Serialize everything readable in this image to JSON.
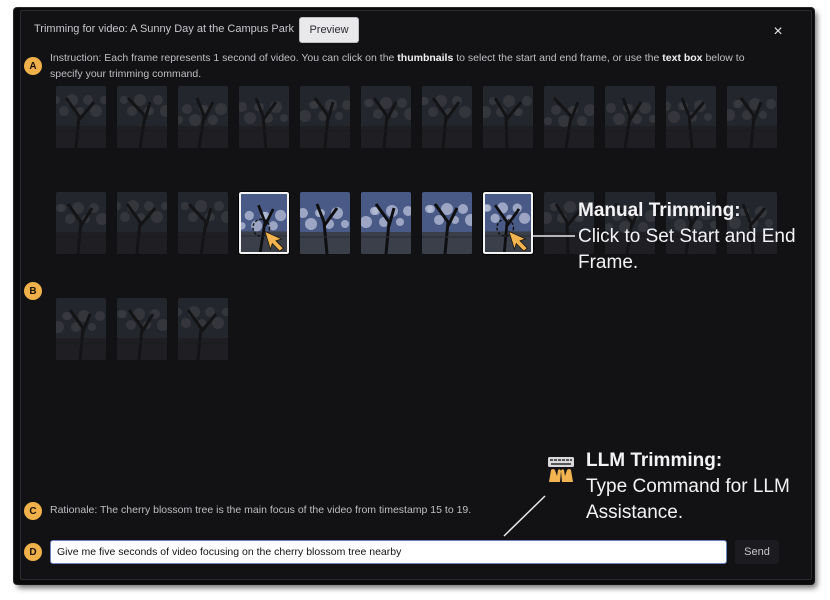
{
  "modal": {
    "title": "Trimming for video: A Sunny Day at the Campus Park",
    "preview_label": "Preview",
    "close_label": "×"
  },
  "badges": {
    "a": "A",
    "b": "B",
    "c": "C",
    "d": "D"
  },
  "instruction": {
    "prefix": "Instruction: Each frame represents 1 second of video. You can click on the ",
    "bold1": "thumbnails",
    "middle": " to select the start and end frame, or use the ",
    "bold2": "text box",
    "suffix": " below to specify your trimming command."
  },
  "frames": {
    "count": 27,
    "per_row": 12,
    "highlighted": [
      15,
      16,
      17,
      18,
      19
    ],
    "selected_start": 15,
    "selected_end": 19
  },
  "annotations": {
    "manual_title": "Manual Trimming:",
    "manual_desc": "Click to Set Start and End Frame.",
    "llm_title": "LLM Trimming:",
    "llm_desc": "Type Command for LLM Assistance."
  },
  "rationale": "Rationale: The cherry blossom tree is the main focus of the video from timestamp 15 to 19.",
  "command": {
    "value": "Give me five seconds of video focusing on the cherry blossom tree nearby"
  },
  "send_label": "Send",
  "icons": {
    "pointer": "cursor-hand-icon",
    "llm": "keyboard-hands-icon"
  },
  "colors": {
    "accent": "#f0b04a",
    "modal_bg": "#121214"
  }
}
